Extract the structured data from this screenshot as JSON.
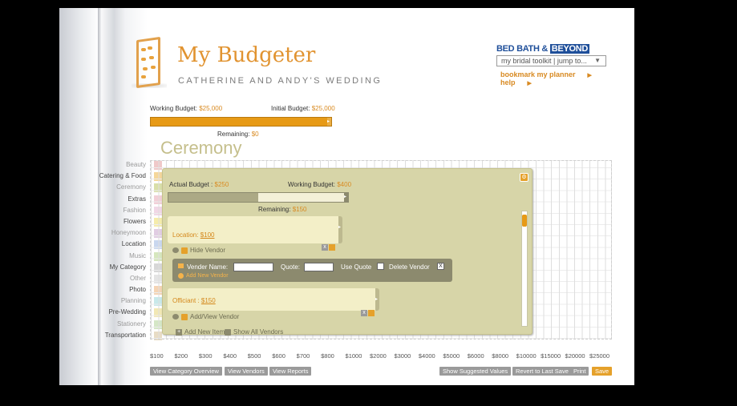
{
  "app": {
    "title": "My Budgeter",
    "subtitle": "CATHERINE AND ANDY'S WEDDING"
  },
  "brand": {
    "name_prefix": "BED BATH & ",
    "name_highlight": "BEYOND",
    "toolkit_label": "my bridal toolkit  |  jump to...",
    "links": [
      "bookmark my planner",
      "help"
    ]
  },
  "budget": {
    "working_label": "Working Budget:",
    "working_value": "$25,000",
    "initial_label": "Initial Budget:",
    "initial_value": "$25,000",
    "remaining_label": "Remaining:",
    "remaining_value": "$0",
    "fill_fraction": 1.0
  },
  "category_title": "Ceremony",
  "categories": [
    {
      "label": "Beauty",
      "color": "#f0c9c9",
      "dim": true
    },
    {
      "label": "Catering & Food",
      "color": "#f5d79a",
      "dim": false
    },
    {
      "label": "Ceremony",
      "color": "#d9dfa8",
      "dim": true
    },
    {
      "label": "Extras",
      "color": "#f2cfd7",
      "dim": false
    },
    {
      "label": "Fashion",
      "color": "#f1d7e6",
      "dim": true
    },
    {
      "label": "Flowers",
      "color": "#f5ecab",
      "dim": false
    },
    {
      "label": "Honeymoon",
      "color": "#e1cde3",
      "dim": true
    },
    {
      "label": "Location",
      "color": "#c9d7ef",
      "dim": false
    },
    {
      "label": "Music",
      "color": "#d6e7bd",
      "dim": true
    },
    {
      "label": "My Category",
      "color": "#d7d7d7",
      "dim": false
    },
    {
      "label": "Other",
      "color": "#e4e4e4",
      "dim": true
    },
    {
      "label": "Photo",
      "color": "#f5d4b4",
      "dim": false
    },
    {
      "label": "Planning",
      "color": "#c8e9ea",
      "dim": true
    },
    {
      "label": "Pre-Wedding",
      "color": "#f2e8b4",
      "dim": false
    },
    {
      "label": "Stationery",
      "color": "#d5e7c6",
      "dim": true
    },
    {
      "label": "Transportation",
      "color": "#e8dcc5",
      "dim": false
    }
  ],
  "panel": {
    "actual_label": "Actual Budget :",
    "actual_value": "$250",
    "working_label": "Working Budget:",
    "working_value": "$400",
    "remaining_label": "Remaining:",
    "remaining_value": "$150",
    "fill_fraction": 0.5,
    "items": [
      {
        "label": "Location:",
        "value": "$100",
        "vendor_toggle": "Hide Vendor"
      },
      {
        "label": "Officiant :",
        "value": "$150",
        "vendor_toggle": "Add/View Vendor"
      }
    ],
    "vendor_form": {
      "name_label": "Vender Name:",
      "name_value": "",
      "quote_label": "Quote:",
      "quote_value": "",
      "use_quote_label": "Use Quote",
      "delete_label": "Delete Vendor",
      "delete_x": "X",
      "add_label": "Add New Vendor"
    },
    "add_item_label": "Add New Item",
    "show_vendors_label": "Show All Vendors"
  },
  "axis_ticks": [
    "$100",
    "$200",
    "$300",
    "$400",
    "$500",
    "$600",
    "$700",
    "$800",
    "$1000",
    "$2000",
    "$3000",
    "$4000",
    "$5000",
    "$6000",
    "$8000",
    "$10000",
    "$15000",
    "$20000",
    "$25000"
  ],
  "footer": {
    "left_buttons": [
      "View Category Overview",
      "View Vendors",
      "View Reports"
    ],
    "right_buttons": [
      "Show Suggested Values",
      "Revert to Last Save",
      "Print",
      "Save"
    ]
  }
}
